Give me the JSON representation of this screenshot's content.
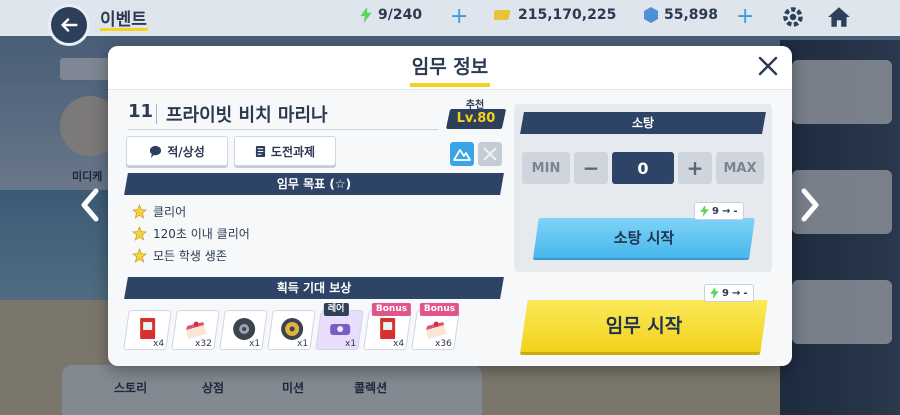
{
  "topbar": {
    "title": "이벤트",
    "ap": "9/240",
    "credits": "215,170,225",
    "gems": "55,898"
  },
  "side_label": "미디케",
  "bottom_tabs": [
    "스토리",
    "상점",
    "미션",
    "콜렉션"
  ],
  "modal": {
    "title": "임무 정보",
    "stage_number": "11",
    "stage_name": "프라이빗 비치 마리나",
    "recommend_label": "추천",
    "recommend_level": "Lv.80",
    "btn_enemy_info": "적/상성",
    "btn_challenge": "도전과제",
    "goals_title": "임무 목표 (☆)",
    "goals": [
      "클리어",
      "120초 이내 클리어",
      "모든 학생 생존"
    ],
    "rewards_title": "획득 기대 보상",
    "rewards": [
      {
        "icon": "report-book-icon",
        "qty": "x4",
        "tag": ""
      },
      {
        "icon": "cake-icon",
        "qty": "x32",
        "tag": ""
      },
      {
        "icon": "gear-disc-icon",
        "qty": "x1",
        "tag": ""
      },
      {
        "icon": "gold-gear-disc-icon",
        "qty": "x1",
        "tag": ""
      },
      {
        "icon": "rare-artifact-icon",
        "qty": "x1",
        "tag": "레어"
      },
      {
        "icon": "report-book-icon",
        "qty": "x4",
        "tag": "Bonus"
      },
      {
        "icon": "cake-icon",
        "qty": "x36",
        "tag": "Bonus"
      }
    ],
    "sweep": {
      "title": "소탕",
      "min_label": "MIN",
      "minus_label": "−",
      "count": "0",
      "plus_label": "+",
      "max_label": "MAX",
      "cost_ap": "9",
      "cost_after": "-",
      "start_label": "소탕 시작"
    },
    "mission": {
      "cost_ap": "9",
      "cost_after": "-",
      "start_label": "임무 시작"
    }
  },
  "colors": {
    "navy": "#2e4466",
    "yellow_button": "#f3d21c",
    "blue_button": "#47b7ec",
    "accent_yellow": "#f4d21e"
  }
}
